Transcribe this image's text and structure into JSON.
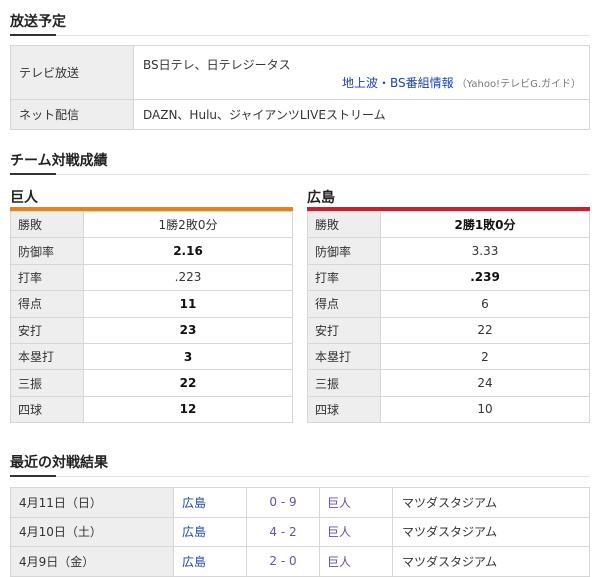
{
  "broadcast": {
    "title": "放送予定",
    "rows": [
      {
        "label": "テレビ放送",
        "value": "BS日テレ、日テレジータス"
      },
      {
        "label": "ネット配信",
        "value": "DAZN、Hulu、ジャイアンツLIVEストリーム"
      }
    ],
    "guide_link": "地上波・BS番組情報",
    "guide_note": "（Yahoo!テレビG.ガイド）"
  },
  "matchup": {
    "title": "チーム対戦成績",
    "home": {
      "name": "巨人",
      "color": "#e8821f",
      "stats": [
        {
          "label": "勝敗",
          "value": "1勝2敗0分",
          "bold": false
        },
        {
          "label": "防御率",
          "value": "2.16",
          "bold": true
        },
        {
          "label": "打率",
          "value": ".223",
          "bold": false
        },
        {
          "label": "得点",
          "value": "11",
          "bold": true
        },
        {
          "label": "安打",
          "value": "23",
          "bold": true
        },
        {
          "label": "本塁打",
          "value": "3",
          "bold": true
        },
        {
          "label": "三振",
          "value": "22",
          "bold": true
        },
        {
          "label": "四球",
          "value": "12",
          "bold": true
        }
      ]
    },
    "away": {
      "name": "広島",
      "color": "#c8202c",
      "stats": [
        {
          "label": "勝敗",
          "value": "2勝1敗0分",
          "bold": true
        },
        {
          "label": "防御率",
          "value": "3.33",
          "bold": false
        },
        {
          "label": "打率",
          "value": ".239",
          "bold": true
        },
        {
          "label": "得点",
          "value": "6",
          "bold": false
        },
        {
          "label": "安打",
          "value": "22",
          "bold": false
        },
        {
          "label": "本塁打",
          "value": "2",
          "bold": false
        },
        {
          "label": "三振",
          "value": "24",
          "bold": false
        },
        {
          "label": "四球",
          "value": "10",
          "bold": false
        }
      ]
    }
  },
  "recent": {
    "title": "最近の対戦結果",
    "results": [
      {
        "date": "4月11日（日）",
        "team1": "広島",
        "score": "0 - 9",
        "team2": "巨人",
        "venue": "マツダスタジアム"
      },
      {
        "date": "4月10日（土）",
        "team1": "広島",
        "score": "4 - 2",
        "team2": "巨人",
        "venue": "マツダスタジアム"
      },
      {
        "date": "4月9日（金）",
        "team1": "広島",
        "score": "2 - 0",
        "team2": "巨人",
        "venue": "マツダスタジアム"
      }
    ]
  }
}
